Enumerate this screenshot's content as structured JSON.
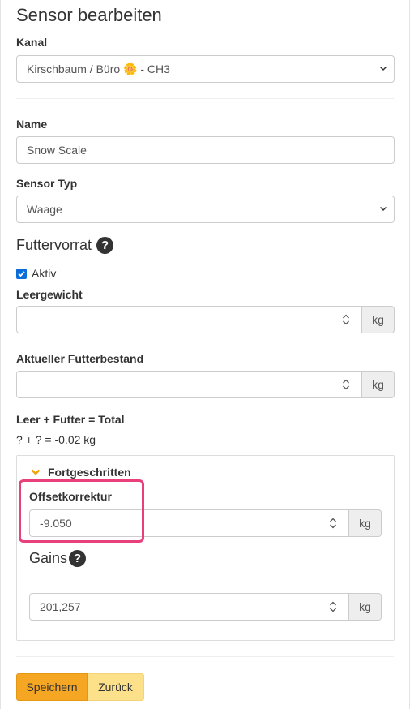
{
  "page": {
    "title": "Sensor bearbeiten"
  },
  "kanal": {
    "label": "Kanal",
    "value": "Kirschbaum / Büro 🌼 - CH3"
  },
  "name": {
    "label": "Name",
    "value": "Snow Scale"
  },
  "sensor_typ": {
    "label": "Sensor Typ",
    "value": "Waage"
  },
  "futtervorrat": {
    "heading": "Futtervorrat",
    "help_icon": "question-circle-icon",
    "aktiv_label": "Aktiv",
    "aktiv_checked": true,
    "leergewicht_label": "Leergewicht",
    "leergewicht_value": "",
    "leergewicht_unit": "kg",
    "bestand_label": "Aktueller Futterbestand",
    "bestand_value": "",
    "bestand_unit": "kg",
    "formula_label": "Leer + Futter = Total",
    "formula_value": "? + ? = -0.02 kg"
  },
  "advanced": {
    "toggle_label": "Fortgeschritten",
    "toggle_icon": "chevron-down-icon",
    "offset_label": "Offsetkorrektur",
    "offset_value": "-9.050",
    "offset_unit": "kg",
    "gains_heading": "Gains",
    "gains_value": "201,257",
    "gains_unit": "kg"
  },
  "actions": {
    "save_label": "Speichern",
    "back_label": "Zurück"
  },
  "colors": {
    "save": "#f5a623",
    "back": "#fde08a",
    "highlight": "#e8407a",
    "chevron": "#f0a30a",
    "checkbox": "#0b6ed8"
  }
}
